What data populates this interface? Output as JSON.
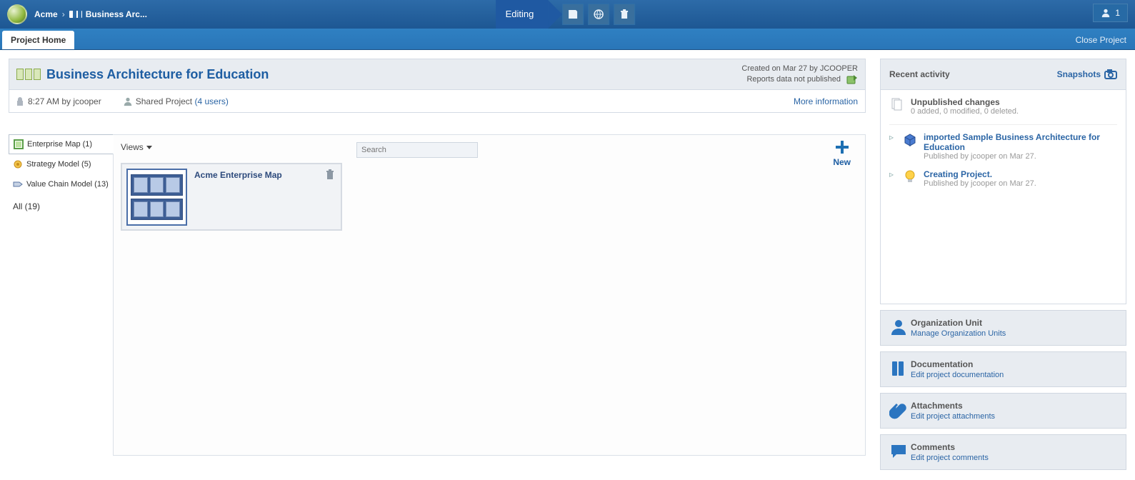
{
  "topbar": {
    "root": "Acme",
    "leaf": "Business Arc...",
    "editing": "Editing",
    "user_count": "1"
  },
  "subbar": {
    "tab": "Project Home",
    "close": "Close Project"
  },
  "project": {
    "title": "Business Architecture for Education",
    "created": "Created on Mar 27 by JCOOPER",
    "reports": "Reports data not published",
    "lock_time": "8:27 AM by jcooper",
    "shared": "Shared Project",
    "shared_users": "(4 users)",
    "more": "More information"
  },
  "tree": {
    "items": [
      {
        "label": "Enterprise Map (1)",
        "icon": "map"
      },
      {
        "label": "Strategy Model (5)",
        "icon": "strategy"
      },
      {
        "label": "Value Chain Model (13)",
        "icon": "chain"
      }
    ],
    "all": "All (19)"
  },
  "canvas": {
    "views": "Views",
    "search_ph": "Search",
    "new": "New",
    "card_title": "Acme Enterprise Map"
  },
  "side": {
    "head": "Recent activity",
    "snapshots": "Snapshots",
    "unpub_title": "Unpublished changes",
    "unpub_sub": "0 added, 0 modified, 0 deleted.",
    "act1_title": "imported Sample Business Architecture for Education",
    "act1_sub": "Published by jcooper on Mar 27.",
    "act2_title": "Creating Project.",
    "act2_sub": "Published by jcooper on Mar 27.",
    "panels": [
      {
        "t": "Organization Unit",
        "l": "Manage Organization Units",
        "ic": "org"
      },
      {
        "t": "Documentation",
        "l": "Edit project documentation",
        "ic": "doc"
      },
      {
        "t": "Attachments",
        "l": "Edit project attachments",
        "ic": "att"
      },
      {
        "t": "Comments",
        "l": "Edit project comments",
        "ic": "com"
      }
    ]
  }
}
